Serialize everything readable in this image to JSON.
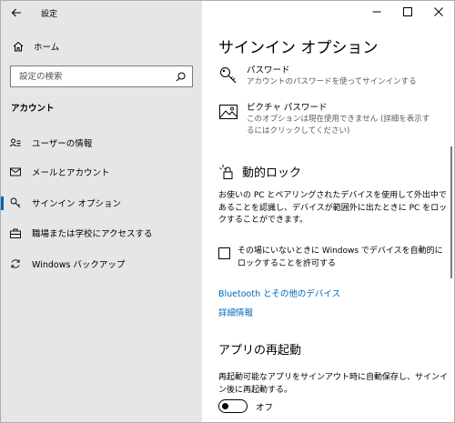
{
  "app": {
    "title": "設定"
  },
  "sidebar": {
    "home_label": "ホーム",
    "search_placeholder": "設定の検索",
    "section_title": "アカウント",
    "items": [
      {
        "label": "ユーザーの情報",
        "icon": "user-info-icon",
        "selected": false
      },
      {
        "label": "メールとアカウント",
        "icon": "mail-icon",
        "selected": false
      },
      {
        "label": "サインイン オプション",
        "icon": "key-icon",
        "selected": true
      },
      {
        "label": "職場または学校にアクセスする",
        "icon": "briefcase-icon",
        "selected": false
      },
      {
        "label": "Windows バックアップ",
        "icon": "sync-icon",
        "selected": false
      }
    ]
  },
  "main": {
    "title": "サインイン オプション",
    "password": {
      "title": "パスワード",
      "desc": "アカウントのパスワードを使ってサインインする"
    },
    "picture_password": {
      "title": "ピクチャ パスワード",
      "desc": "このオプションは現在使用できません (詳細を表示するにはクリックしてください)"
    },
    "dynamic_lock": {
      "title": "動的ロック",
      "desc": "お使いの PC とペアリングされたデバイスを使用して外出中であることを認識し、デバイスが範囲外に出たときに PC をロックすることができます。",
      "checkbox_label": "その場にいないときに Windows でデバイスを自動的にロックすることを許可する",
      "checked": false
    },
    "links": {
      "bluetooth": "Bluetooth とその他のデバイス",
      "more_info": "詳細情報"
    },
    "app_restart": {
      "title": "アプリの再起動",
      "desc": "再起動可能なアプリをサインアウト時に自動保存し、サインイン後に再起動する。",
      "toggle_label": "オフ",
      "toggle_on": false
    }
  },
  "colors": {
    "accent": "#0063b1",
    "link": "#0066b4",
    "sidebar_bg": "#e6e6e6"
  }
}
